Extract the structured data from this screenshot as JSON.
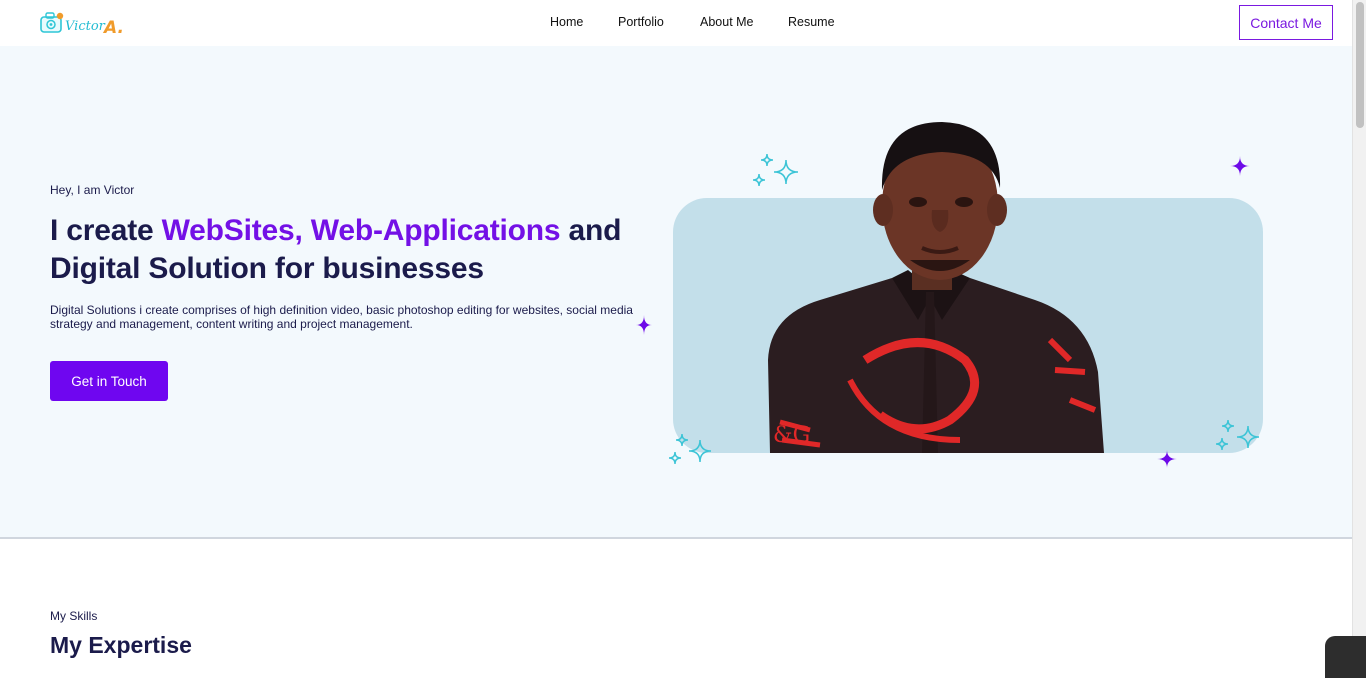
{
  "header": {
    "logo_text": "VictorA.",
    "nav": {
      "home": "Home",
      "portfolio": "Portfolio",
      "about": "About Me",
      "resume": "Resume"
    },
    "contact_label": "Contact Me"
  },
  "hero": {
    "greeting": "Hey, I am Victor",
    "headline_prefix": "I create ",
    "headline_accent": "WebSites, Web-Applications",
    "headline_suffix": " and Digital Solution for businesses",
    "description": "Digital Solutions i create comprises of high definition video, basic photoshop editing for websites, social media strategy and management, content writing and project management.",
    "cta_label": "Get in Touch",
    "portrait_image": "portrait-photo"
  },
  "skills": {
    "kicker": "My Skills",
    "title": "My Expertise"
  },
  "colors": {
    "accent": "#7310e6",
    "button": "#6f06f0",
    "text_dark": "#1b1b4b",
    "hero_bg": "#f3f9fd",
    "portrait_card": "#c3dfea",
    "sparkle_teal": "#3cc4d6",
    "sparkle_purple": "#6d0ae8"
  }
}
